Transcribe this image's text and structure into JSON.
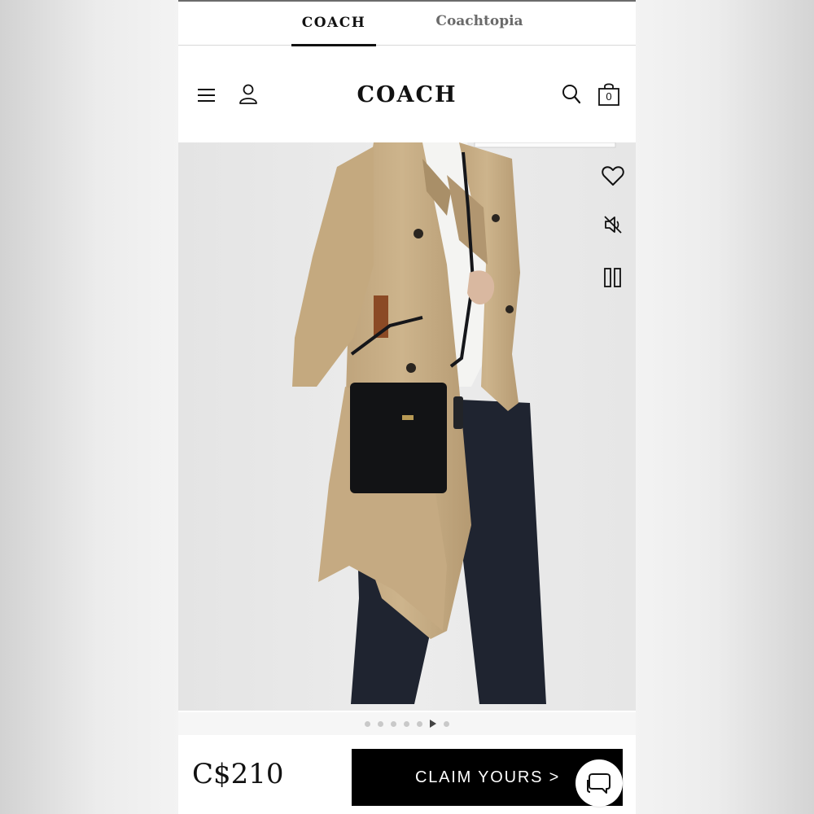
{
  "brand_tabs": [
    {
      "label": "COACH",
      "active": true
    },
    {
      "label": "Coachtopia",
      "active": false
    }
  ],
  "header": {
    "logo": "COACH",
    "bag_count": "0",
    "icons": [
      "menu-icon",
      "account-icon",
      "search-icon",
      "bag-icon"
    ]
  },
  "media": {
    "controls": [
      "heart-icon",
      "mute-icon",
      "pause-icon"
    ],
    "carousel": {
      "count": 7,
      "active_index": 5
    }
  },
  "purchase": {
    "price": "C$210",
    "cta_label": "CLAIM YOURS >"
  },
  "chat": {
    "icon": "chat-icon"
  },
  "colors": {
    "accent": "#000000",
    "background": "#ffffff"
  }
}
